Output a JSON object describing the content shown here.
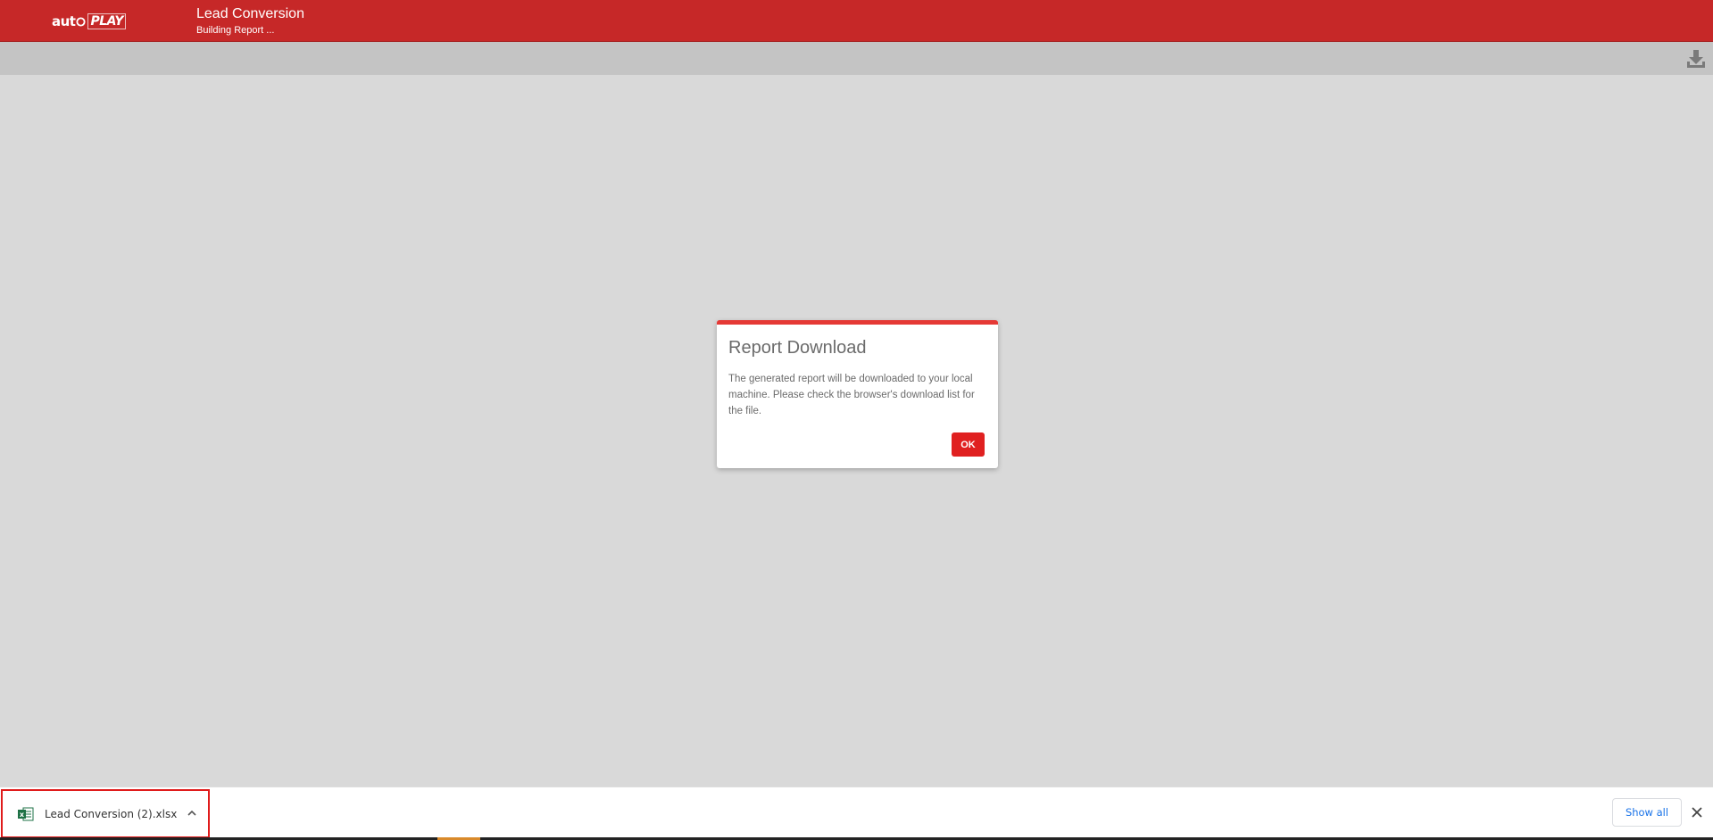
{
  "header": {
    "logo_text_a": "aut",
    "logo_text_b": "PLAY",
    "title": "Lead Conversion",
    "subtitle": "Building Report ..."
  },
  "toolbar": {
    "download_icon": "download-icon"
  },
  "modal": {
    "title": "Report Download",
    "body": "The generated report will be downloaded to your local machine. Please check the browser's download list for the file.",
    "ok_label": "OK",
    "accent_color": "#e53935"
  },
  "download_shelf": {
    "file_name": "Lead Conversion (2).xlsx",
    "file_icon": "excel-file-icon",
    "show_all_label": "Show all",
    "close_icon": "close-icon"
  },
  "colors": {
    "header": "#c62828",
    "toolbar": "#c4c4c4",
    "background": "#d9d9d9",
    "ok_button": "#e02020",
    "show_all_text": "#1a73e8"
  }
}
